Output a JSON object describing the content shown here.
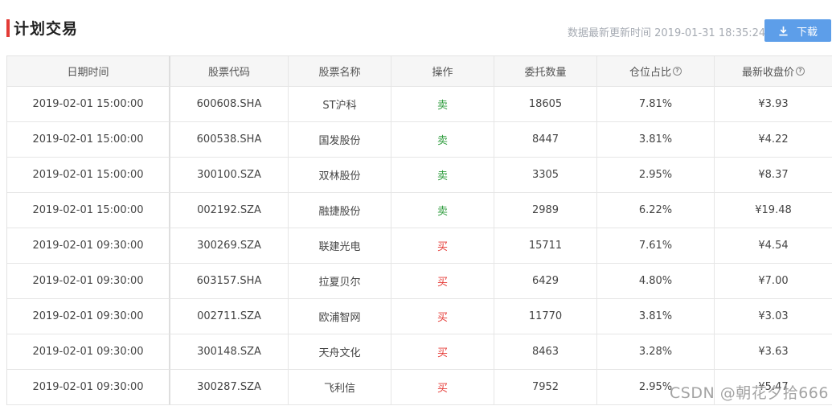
{
  "header": {
    "title": "计划交易",
    "update_time": "数据最新更新时间 2019-01-31 18:35:24",
    "download_label": "下载"
  },
  "table": {
    "columns": [
      "日期时间",
      "股票代码",
      "股票名称",
      "操作",
      "委托数量",
      "仓位占比",
      "最新收盘价"
    ],
    "rows": [
      {
        "datetime": "2019-02-01 15:00:00",
        "code": "600608.SHA",
        "name": "ST沪科",
        "action": "卖",
        "action_type": "sell",
        "quantity": "18605",
        "position": "7.81%",
        "price": "¥3.93"
      },
      {
        "datetime": "2019-02-01 15:00:00",
        "code": "600538.SHA",
        "name": "国发股份",
        "action": "卖",
        "action_type": "sell",
        "quantity": "8447",
        "position": "3.81%",
        "price": "¥4.22"
      },
      {
        "datetime": "2019-02-01 15:00:00",
        "code": "300100.SZA",
        "name": "双林股份",
        "action": "卖",
        "action_type": "sell",
        "quantity": "3305",
        "position": "2.95%",
        "price": "¥8.37"
      },
      {
        "datetime": "2019-02-01 15:00:00",
        "code": "002192.SZA",
        "name": "融捷股份",
        "action": "卖",
        "action_type": "sell",
        "quantity": "2989",
        "position": "6.22%",
        "price": "¥19.48"
      },
      {
        "datetime": "2019-02-01 09:30:00",
        "code": "300269.SZA",
        "name": "联建光电",
        "action": "买",
        "action_type": "buy",
        "quantity": "15711",
        "position": "7.61%",
        "price": "¥4.54"
      },
      {
        "datetime": "2019-02-01 09:30:00",
        "code": "603157.SHA",
        "name": "拉夏贝尔",
        "action": "买",
        "action_type": "buy",
        "quantity": "6429",
        "position": "4.80%",
        "price": "¥7.00"
      },
      {
        "datetime": "2019-02-01 09:30:00",
        "code": "002711.SZA",
        "name": "欧浦智网",
        "action": "买",
        "action_type": "buy",
        "quantity": "11770",
        "position": "3.81%",
        "price": "¥3.03"
      },
      {
        "datetime": "2019-02-01 09:30:00",
        "code": "300148.SZA",
        "name": "天舟文化",
        "action": "买",
        "action_type": "buy",
        "quantity": "8463",
        "position": "3.28%",
        "price": "¥3.63"
      },
      {
        "datetime": "2019-02-01 09:30:00",
        "code": "300287.SZA",
        "name": "飞利信",
        "action": "买",
        "action_type": "buy",
        "quantity": "7952",
        "position": "2.95%",
        "price": "¥5.47"
      }
    ]
  },
  "watermark": "CSDN @朝花夕拾666",
  "colors": {
    "accent": "#e33b36",
    "button": "#5d9ee9",
    "sell": "#2e9c3d",
    "buy": "#e53935"
  },
  "icons": {
    "download": "download-icon",
    "help": "question-circle-icon"
  }
}
